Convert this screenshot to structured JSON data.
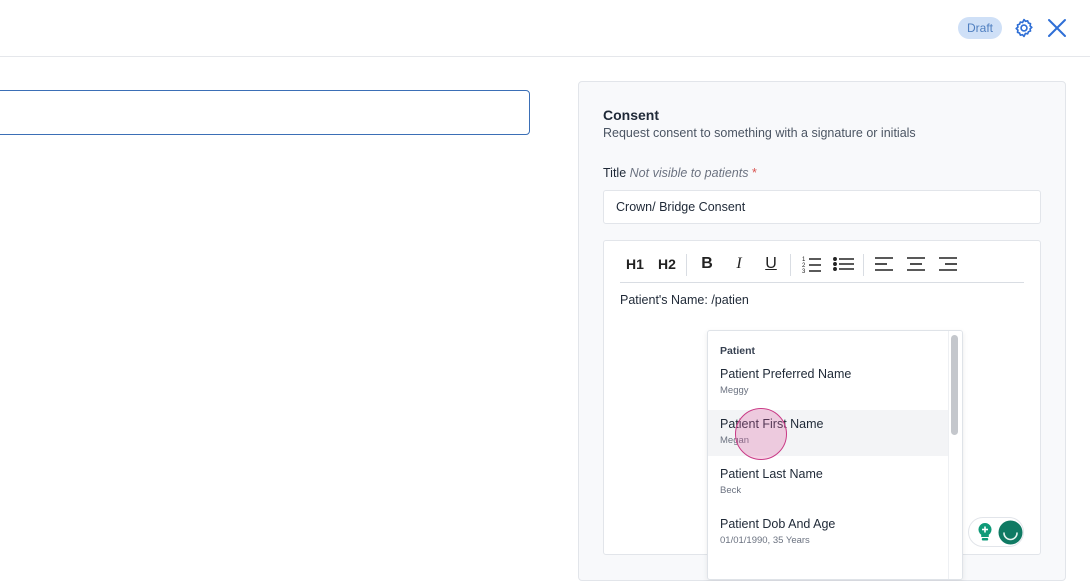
{
  "header": {
    "badge": "Draft",
    "settings_icon": "gear-icon",
    "close_icon": "close-icon"
  },
  "left": {
    "input_value": ""
  },
  "panel": {
    "title": "Consent",
    "subtitle": "Request consent to something with a signature or initials",
    "field_label": "Title",
    "field_hint": "Not visible to patients",
    "field_required": "*",
    "title_value": "Crown/ Bridge Consent"
  },
  "toolbar": {
    "h1": "H1",
    "h2": "H2",
    "bold": "B",
    "italic": "I",
    "underline": "U"
  },
  "editor": {
    "text": "Patient's Name: /patien"
  },
  "dropdown": {
    "header": "Patient",
    "items": [
      {
        "name": "Patient Preferred Name",
        "value": "Meggy"
      },
      {
        "name": "Patient First Name",
        "value": "Megan"
      },
      {
        "name": "Patient Last Name",
        "value": "Beck"
      },
      {
        "name": "Patient Dob And Age",
        "value": "01/01/1990, 35 Years"
      }
    ]
  },
  "colors": {
    "accent": "#3b6fb6",
    "badge_bg": "#cfe0f7",
    "required": "#d9534f",
    "assistant": "#0f7a63"
  }
}
